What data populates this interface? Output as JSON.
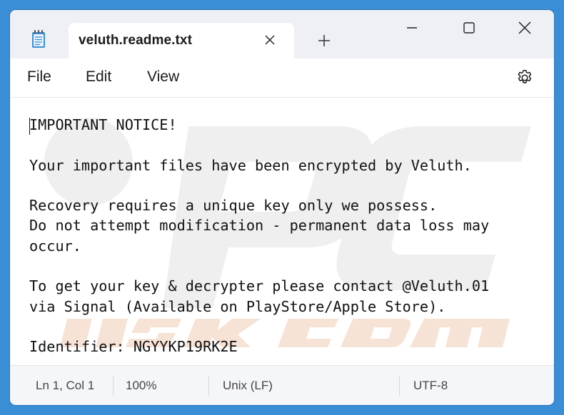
{
  "tab": {
    "title": "veluth.readme.txt",
    "new_tab_label": "+"
  },
  "menu": {
    "file": "File",
    "edit": "Edit",
    "view": "View"
  },
  "icons": {
    "app": "notepad-icon",
    "close_tab": "close-icon",
    "new_tab": "plus-icon",
    "minimize": "minimize-icon",
    "maximize": "maximize-icon",
    "close_window": "close-icon",
    "settings": "gear-icon"
  },
  "document": {
    "lines": [
      "IMPORTANT NOTICE!",
      "",
      "Your important files have been encrypted by Veluth.",
      "",
      "Recovery requires a unique key only we possess.",
      "Do not attempt modification - permanent data loss may",
      "occur.",
      "",
      "To get your key & decrypter please contact @Veluth.01",
      "via Signal (Available on PlayStore/Apple Store).",
      "",
      "Identifier: NGYYKP19RK2E"
    ]
  },
  "status": {
    "position": "Ln 1, Col 1",
    "zoom": "100%",
    "line_ending": "Unix (LF)",
    "encoding": "UTF-8"
  },
  "colors": {
    "desktop": "#3a8ed6",
    "titlebar": "#eef0f5",
    "text": "#111111",
    "watermark": "#e8e8e8",
    "watermark_accent": "#f5d9c7"
  }
}
